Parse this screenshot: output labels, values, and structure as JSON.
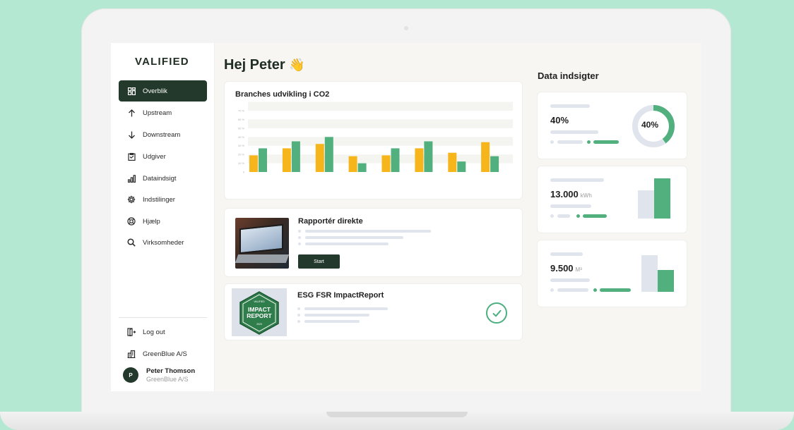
{
  "brand": {
    "logo": "VALIFIED"
  },
  "sidebar": {
    "items": [
      {
        "label": "Overblik",
        "icon": "grid-icon",
        "active": true
      },
      {
        "label": "Upstream",
        "icon": "arrow-up-icon"
      },
      {
        "label": "Downstream",
        "icon": "arrow-down-icon"
      },
      {
        "label": "Udgiver",
        "icon": "clipboard-icon"
      },
      {
        "label": "Dataindsigt",
        "icon": "bar-chart-icon"
      },
      {
        "label": "Indstilinger",
        "icon": "gear-icon"
      },
      {
        "label": "Hjælp",
        "icon": "lifebuoy-icon"
      },
      {
        "label": "Virksomheder",
        "icon": "search-icon"
      }
    ],
    "bottom": [
      {
        "label": "Log out",
        "icon": "logout-icon"
      },
      {
        "label": "GreenBlue A/S",
        "icon": "building-icon"
      }
    ],
    "user": {
      "initial": "P",
      "name": "Peter Thomson",
      "company": "GreenBlue A/S"
    }
  },
  "main": {
    "greeting": "Hej Peter",
    "greeting_emoji": "👋",
    "report": {
      "title": "Rapportér direkte",
      "button": "Start"
    },
    "esg": {
      "title": "ESG FSR ImpactReport",
      "badge_top": "VALIFIED",
      "badge_line1": "IMPACT",
      "badge_line2": "REPORT",
      "badge_bottom": "2023"
    }
  },
  "insights": {
    "title": "Data indsigter",
    "cards": [
      {
        "value": "40%",
        "unit": "",
        "donut_label": "40%",
        "donut_fraction": 0.4
      },
      {
        "value": "13.000",
        "unit": "kWh"
      },
      {
        "value": "9.500",
        "unit": "M³"
      }
    ]
  },
  "colors": {
    "accent_dark": "#22392b",
    "green": "#52b07f",
    "orange": "#f7b51c",
    "muted": "#e0e4ec",
    "background": "#b5e8d3"
  },
  "chart_data": {
    "type": "bar",
    "title": "Branches udvikling i CO2",
    "ylim": [
      0,
      70
    ],
    "yticks": [
      "0",
      "10 %",
      "20 %",
      "30 %",
      "40 %",
      "50 %",
      "60 %",
      "70 %"
    ],
    "categories": [
      "",
      "",
      "",
      "",
      "",
      "",
      "",
      ""
    ],
    "series": [
      {
        "values": [
          19,
          27,
          32,
          18,
          19,
          27,
          22,
          34
        ],
        "color": "#f7b51c"
      },
      {
        "values": [
          27,
          35,
          40,
          10,
          27,
          35,
          12,
          18
        ],
        "color": "#52b07f"
      }
    ],
    "grid": true
  }
}
